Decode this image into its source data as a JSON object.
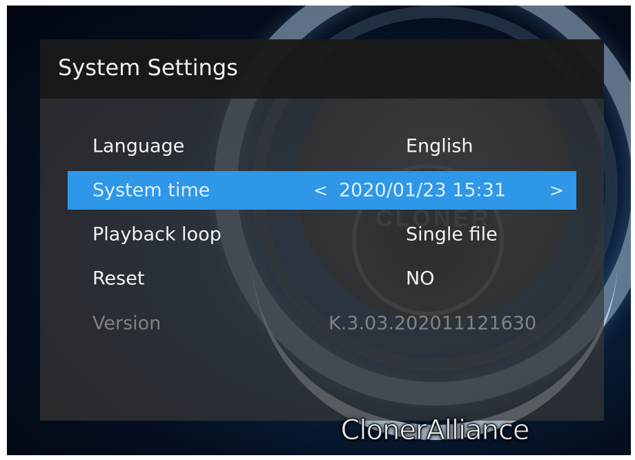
{
  "brand": {
    "logo_text": "ClonerAlliance"
  },
  "settings": {
    "title": "System Settings",
    "rows": [
      {
        "label": "Language",
        "value": "English"
      },
      {
        "label": "System time",
        "value": "2020/01/23 15:31",
        "prev_arrow": "<",
        "next_arrow": ">"
      },
      {
        "label": "Playback loop",
        "value": "Single file"
      },
      {
        "label": "Reset",
        "value": "NO"
      },
      {
        "label": "Version",
        "value": "K.3.03.202011121630"
      }
    ],
    "selected_index": 1
  },
  "colors": {
    "highlight": "#2e97e8",
    "panel": "#373737",
    "header": "#161616",
    "text": "#f4f4f4",
    "disabled_text": "#828282"
  }
}
